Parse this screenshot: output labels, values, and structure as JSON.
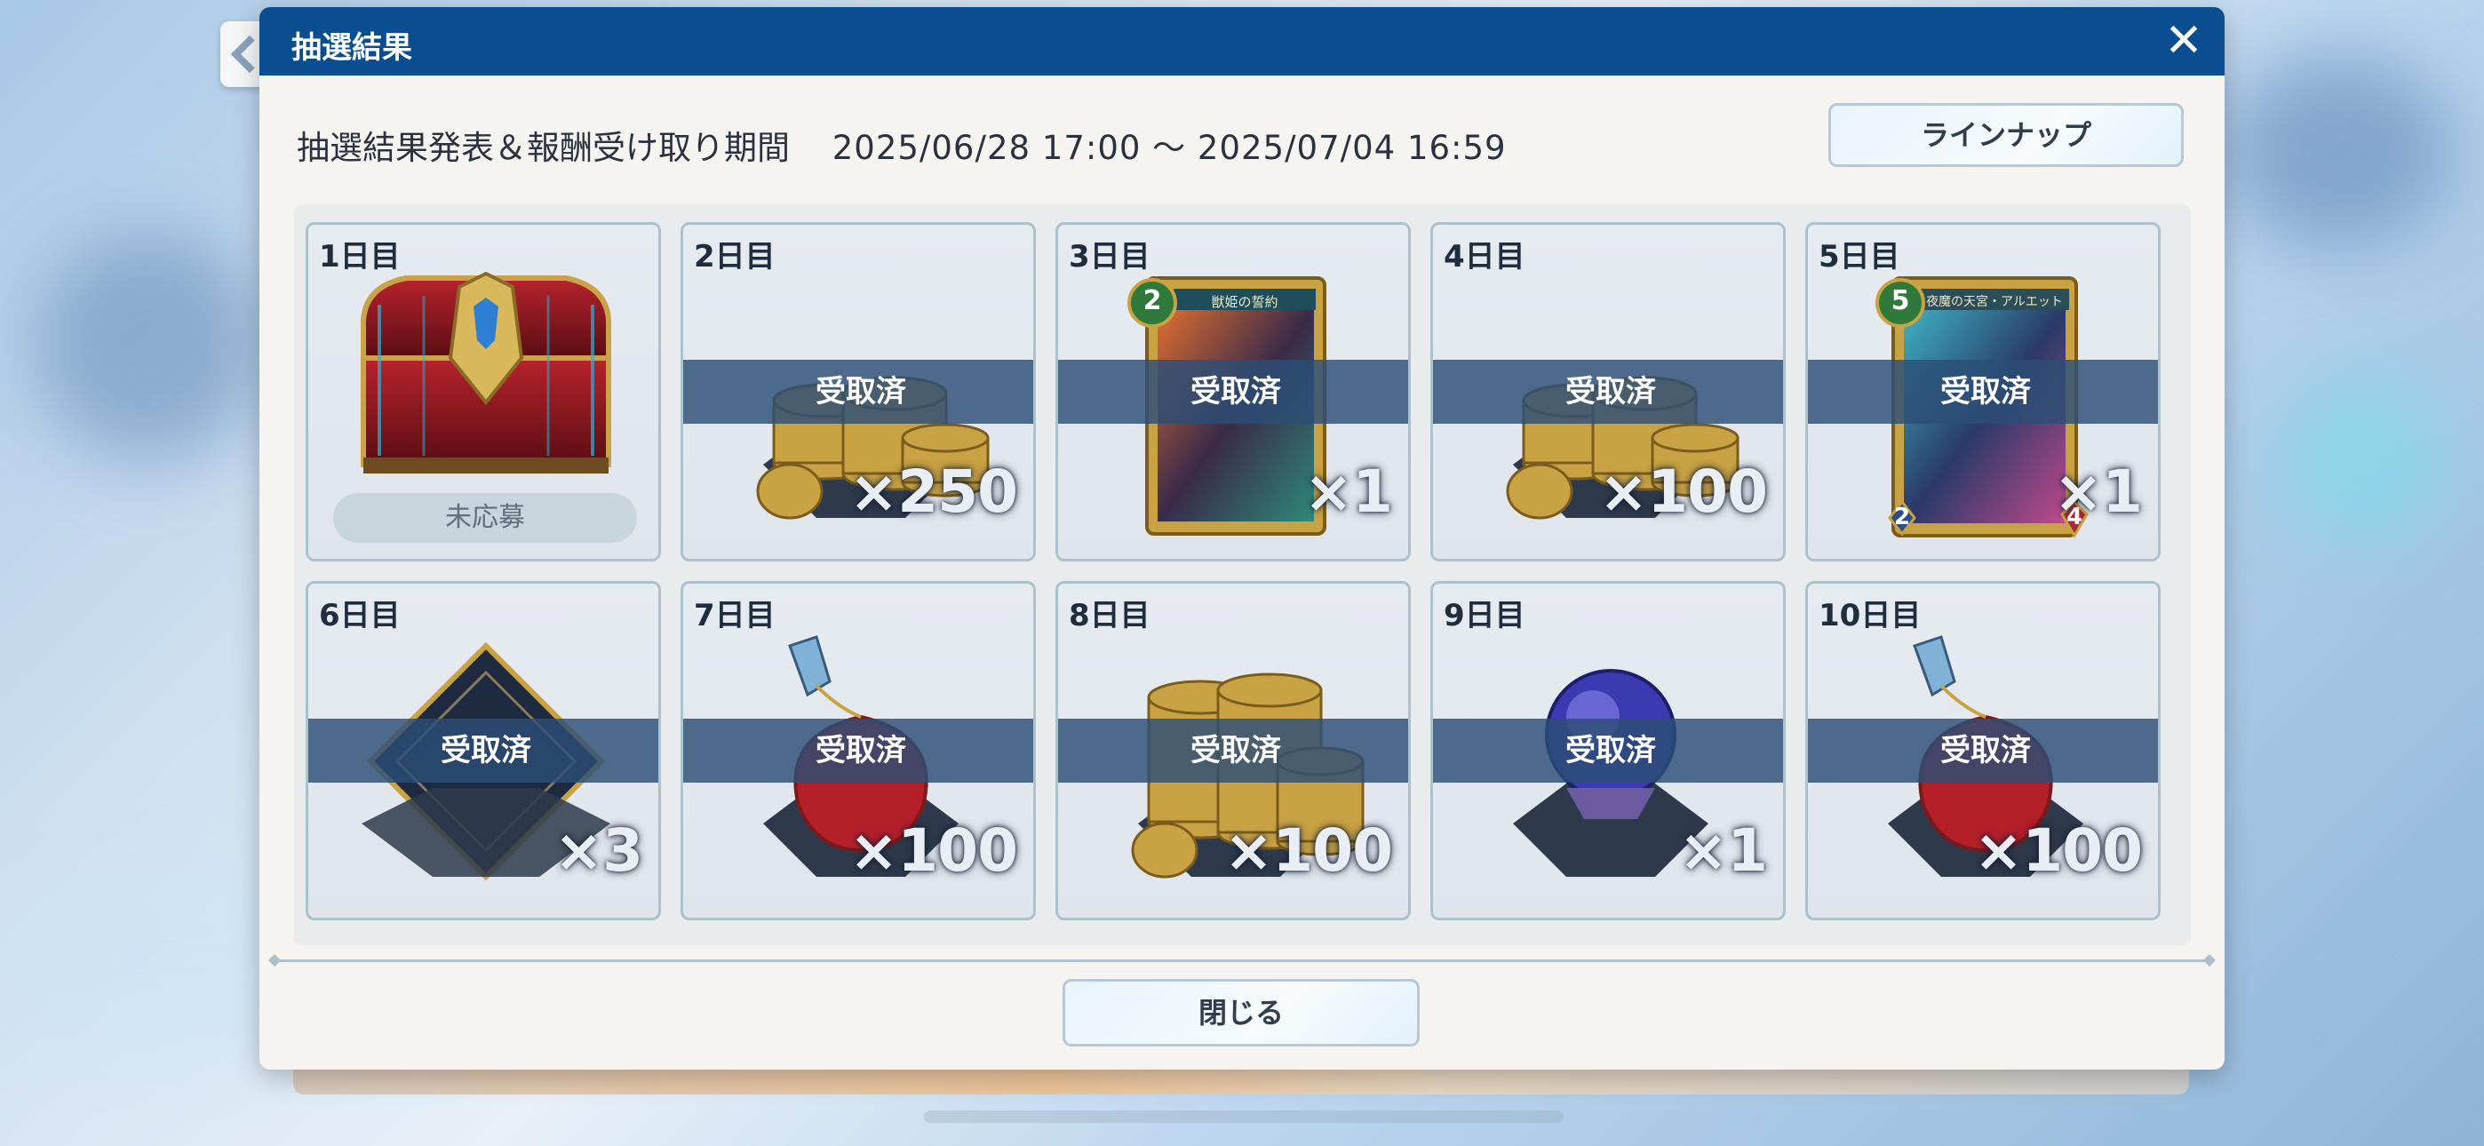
{
  "dialog": {
    "title": "抽選結果",
    "close_icon": "close-icon",
    "period_label": "抽選結果発表＆報酬受け取り期間",
    "period_value": "2025/06/28 17:00 ～ 2025/07/04 16:59",
    "lineup_label": "ラインナップ",
    "close_label": "閉じる"
  },
  "days": [
    {
      "label": "1日目",
      "reward": "treasure-chest-icon",
      "qty": "",
      "status": "未応募",
      "received": false
    },
    {
      "label": "2日目",
      "reward": "coin-stack-icon",
      "qty": "×250",
      "status": "受取済",
      "received": true
    },
    {
      "label": "3日目",
      "reward": "card-icon",
      "qty": "×1",
      "status": "受取済",
      "received": true
    },
    {
      "label": "4日目",
      "reward": "coin-stack-icon",
      "qty": "×100",
      "status": "受取済",
      "received": true
    },
    {
      "label": "5日目",
      "reward": "card-icon",
      "qty": "×1",
      "status": "受取済",
      "received": true
    },
    {
      "label": "6日目",
      "reward": "card-sleeve-icon",
      "qty": "×3",
      "status": "受取済",
      "received": true
    },
    {
      "label": "7日目",
      "reward": "potion-icon",
      "qty": "×100",
      "status": "受取済",
      "received": true
    },
    {
      "label": "8日目",
      "reward": "coin-stack-icon",
      "qty": "×100",
      "status": "受取済",
      "received": true
    },
    {
      "label": "9日目",
      "reward": "crystal-orb-icon",
      "qty": "×1",
      "status": "受取済",
      "received": true
    },
    {
      "label": "10日目",
      "reward": "potion-icon",
      "qty": "×100",
      "status": "受取済",
      "received": true
    }
  ],
  "cards": {
    "day3": {
      "cost": "2",
      "name": "獣姫の誓約"
    },
    "day5": {
      "cost": "5",
      "name": "夜魔の天宮・アルエット",
      "atk": "2",
      "hp": "4"
    }
  }
}
